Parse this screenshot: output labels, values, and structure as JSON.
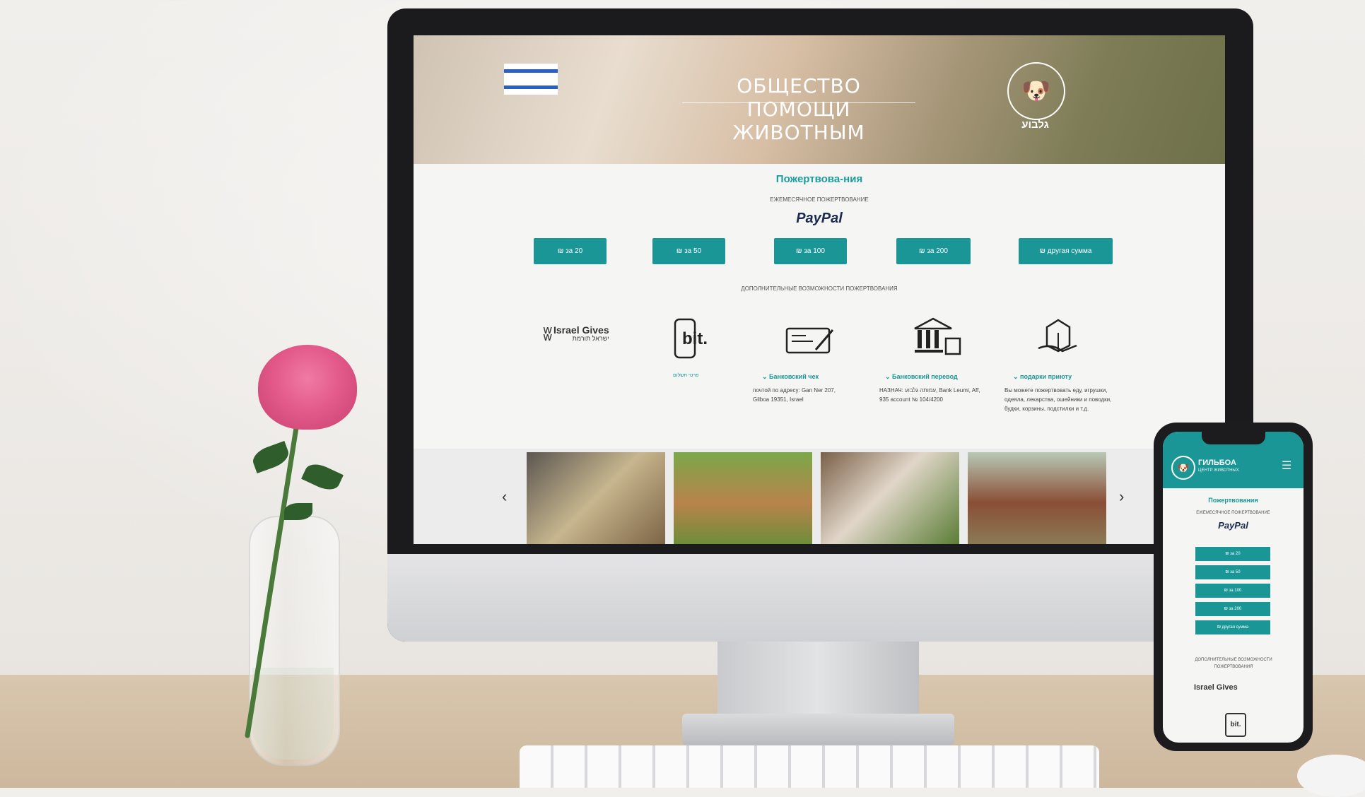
{
  "website": {
    "hero": {
      "title": "ОБЩЕСТВО ПОМОЩИ ЖИВОТНЫМ",
      "logo_text": "גלבוע"
    },
    "donations": {
      "title": "Пожертвова-ния",
      "subtitle": "ЕЖЕМЕСЯЧНОЕ ПОЖЕРТВОВАНИЕ",
      "paypal_label": "PayPal",
      "buttons": [
        "₪ за 20",
        "₪ за 50",
        "₪ за 100",
        "₪ за 200",
        "₪ другая сумма"
      ],
      "extra_title": "ДОПОЛНИТЕЛЬНЫЕ ВОЗМОЖНОСТИ ПОЖЕРТВОВАНИЯ"
    },
    "options": {
      "israel_gives": "Israel Gives",
      "israel_gives_he": "ישראל תורמת",
      "bit_label": "bit.",
      "bit_sub": "פרטי תשלום",
      "check": {
        "title": "Банковский чек",
        "text": "почтой по адресу: Gan Ner 207, Gilboa 19351, Israel"
      },
      "bank": {
        "title": "Банковский перевод",
        "text": "НАЗНАЧ: עמותה גלבוע, Bank Leumi, Aff, 935 account № 104/4200"
      },
      "gift": {
        "title": "подарки приюту",
        "text": "Вы можете пожертвовать еду, игрушки, одеяла, лекарства, ошейники и поводки, будки, корзины, подстилки и т.д."
      }
    },
    "gallery": {
      "prev": "‹",
      "next": "›"
    }
  },
  "phone": {
    "brand": "ГИЛЬБОА",
    "brand_sub": "ЦЕНТР ЖИВОТНЫХ",
    "title": "Пожертвования",
    "subtitle": "ЕЖЕМЕСЯЧНОЕ ПОЖЕРТВОВАНИЕ",
    "paypal_label": "PayPal",
    "buttons": [
      "₪ за 20",
      "₪ за 50",
      "₪ за 100",
      "₪ за 200",
      "₪ другая сумма"
    ],
    "extra_title": "ДОПОЛНИТЕЛЬНЫЕ ВОЗМОЖНОСТИ ПОЖЕРТВОВАНИЯ",
    "israel_gives": "Israel Gives",
    "bit_label": "bit."
  },
  "colors": {
    "accent": "#1a9696",
    "paypal": "#1b2a4e"
  }
}
